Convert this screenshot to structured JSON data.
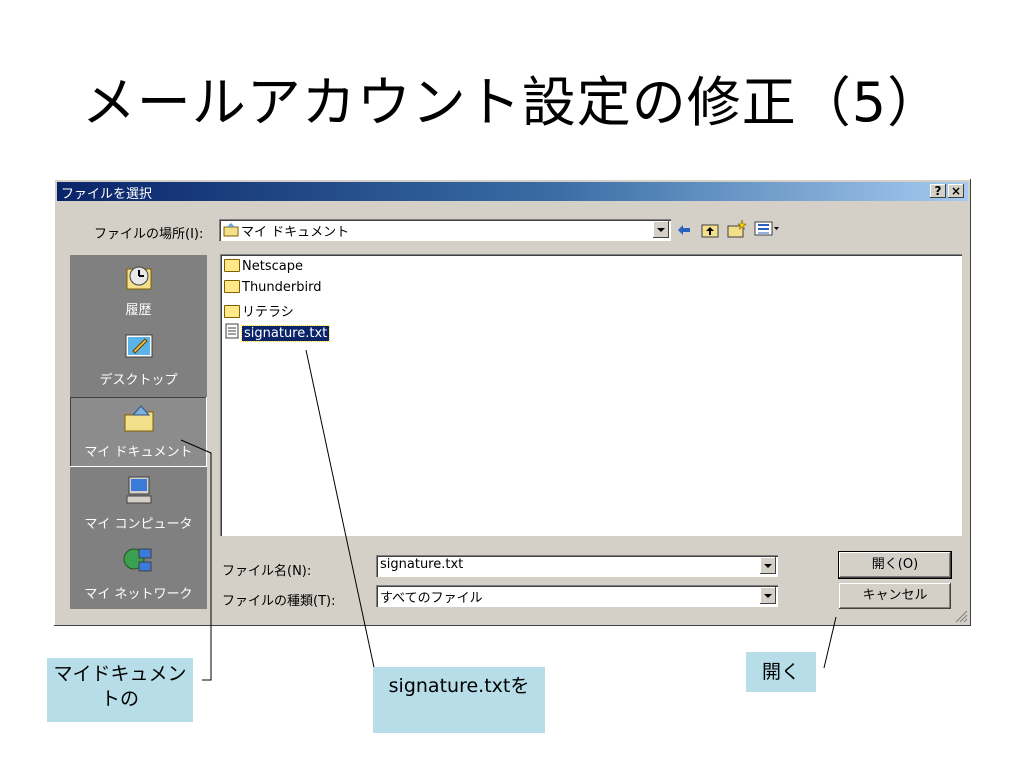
{
  "slide": {
    "title": "メールアカウント設定の修正（5）"
  },
  "dialog": {
    "title": "ファイルを選択",
    "help_label": "?",
    "close_label": "×",
    "location_label": "ファイルの場所(I):",
    "location_value": "マイ ドキュメント",
    "places": [
      {
        "label": "履歴",
        "icon": "history-icon"
      },
      {
        "label": "デスクトップ",
        "icon": "desktop-icon"
      },
      {
        "label": "マイ ドキュメント",
        "icon": "my-documents-icon"
      },
      {
        "label": "マイ コンピュータ",
        "icon": "my-computer-icon"
      },
      {
        "label": "マイ ネットワーク",
        "icon": "my-network-icon"
      }
    ],
    "files": [
      {
        "name": "Netscape",
        "type": "folder"
      },
      {
        "name": "Thunderbird",
        "type": "folder"
      },
      {
        "name": "リテラシ",
        "type": "folder"
      },
      {
        "name": "signature.txt",
        "type": "file",
        "selected": true
      }
    ],
    "filename_label": "ファイル名(N):",
    "filename_value": "signature.txt",
    "filetype_label": "ファイルの種類(T):",
    "filetype_value": "すべてのファイル",
    "open_button": "開く(O)",
    "cancel_button": "キャンセル",
    "toolbar_icons": [
      "back-icon",
      "up-folder-icon",
      "new-folder-icon",
      "view-menu-icon"
    ]
  },
  "callouts": {
    "my_documents": "マイドキュメントの",
    "signature": "signature.txtを",
    "open": "開く"
  },
  "colors": {
    "titlebar": "#0a246a",
    "dialog_bg": "#d4d0c8",
    "callout_bg": "#b6dde8",
    "selection": "#0a246a"
  }
}
